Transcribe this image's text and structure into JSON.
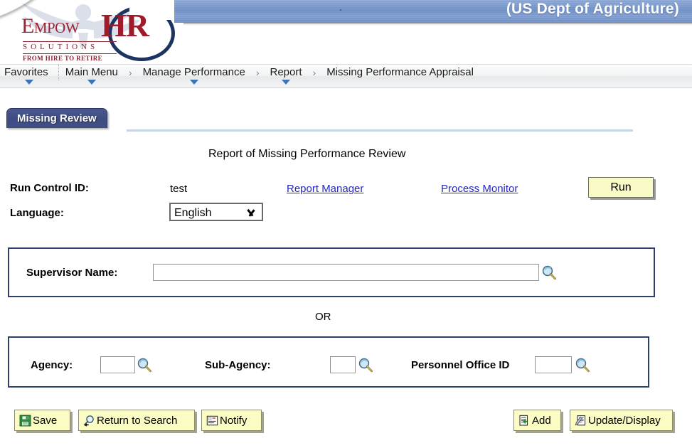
{
  "header": {
    "banner_title": "(US Dept of Agriculture)",
    "logo": {
      "brand_empow": "Empow",
      "brand_hr": "HR",
      "tagline_solutions": "SOLUTIONS",
      "tagline_motto": "FROM HIRE TO RETIRE"
    }
  },
  "nav": {
    "items": [
      {
        "label": "Favorites",
        "has_caret": true
      },
      {
        "label": "Main Menu",
        "has_caret": true
      },
      {
        "label": "Manage Performance",
        "has_caret": true
      },
      {
        "label": "Report",
        "has_caret": true
      },
      {
        "label": "Missing Performance Appraisal",
        "has_caret": false
      }
    ],
    "separator": "›"
  },
  "tabs": {
    "active": "Missing Review"
  },
  "main": {
    "page_title": "Report of Missing Performance Review",
    "run_control": {
      "label": "Run Control ID:",
      "value": "test"
    },
    "language": {
      "label": "Language:",
      "value": "English",
      "options": [
        "English"
      ]
    },
    "links": {
      "report_manager": "Report Manager",
      "process_monitor": "Process Monitor"
    },
    "run_button": "Run",
    "supervisor": {
      "label": "Supervisor Name:",
      "value": "",
      "placeholder": ""
    },
    "or_text": "OR",
    "agency": {
      "label": "Agency:",
      "value": ""
    },
    "sub_agency": {
      "label": "Sub-Agency:",
      "value": ""
    },
    "personnel_office": {
      "label": "Personnel Office ID",
      "value": ""
    }
  },
  "footer": {
    "save": "Save",
    "return_to_search": "Return to Search",
    "notify": "Notify",
    "add": "Add",
    "update_display": "Update/Display"
  },
  "colors": {
    "banner_blue": "#6f8fc6",
    "tab_navy": "#404e84",
    "link_blue": "#2727c6",
    "groupbox_border": "#2d3f6b",
    "button_yellow": "#fbfbc4",
    "run_button_yellow": "#fafac8",
    "logo_red": "#9e1b2a"
  }
}
